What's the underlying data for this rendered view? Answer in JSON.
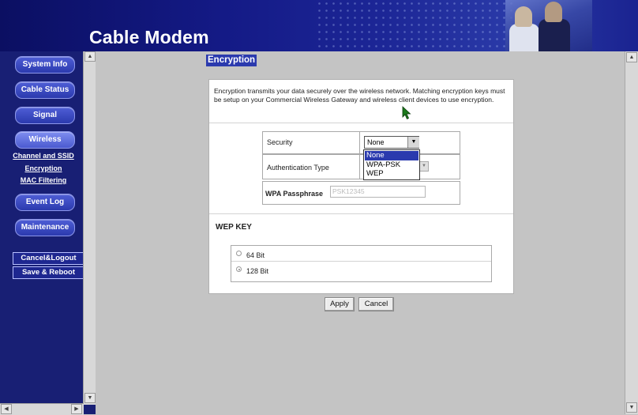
{
  "header": {
    "title": "Cable Modem"
  },
  "sidebar": {
    "items": [
      {
        "label": "System Info"
      },
      {
        "label": "Cable Status"
      },
      {
        "label": "Signal"
      },
      {
        "label": "Wireless"
      },
      {
        "label": "Event Log"
      },
      {
        "label": "Maintenance"
      }
    ],
    "sublinks": [
      {
        "label": "Channel and SSID"
      },
      {
        "label": "Encryption"
      },
      {
        "label": "MAC Filtering"
      }
    ],
    "actions": [
      {
        "label": "Cancel&Logout"
      },
      {
        "label": "Save & Reboot"
      }
    ]
  },
  "main": {
    "title": "Encryption",
    "description": "Encryption transmits your data securely over the wireless network. Matching encryption keys must be setup on your Commercial Wireless Gateway and wireless client devices to use encryption.",
    "security": {
      "label": "Security",
      "value": "None",
      "options": [
        "None",
        "WPA-PSK",
        "WEP"
      ]
    },
    "auth_label": "Authentication Type",
    "passphrase": {
      "label": "WPA Passphrase",
      "value": "PSK12345"
    },
    "wep": {
      "title": "WEP KEY",
      "options": [
        {
          "label": "64 Bit",
          "checked": false
        },
        {
          "label": "128 Bit",
          "checked": true
        }
      ]
    },
    "buttons": {
      "apply": "Apply",
      "cancel": "Cancel"
    }
  },
  "colors": {
    "header_bg": "#141a86",
    "sidebar_bg": "#181f74",
    "accent": "#2b3aae",
    "content_bg": "#c4c4c4"
  }
}
